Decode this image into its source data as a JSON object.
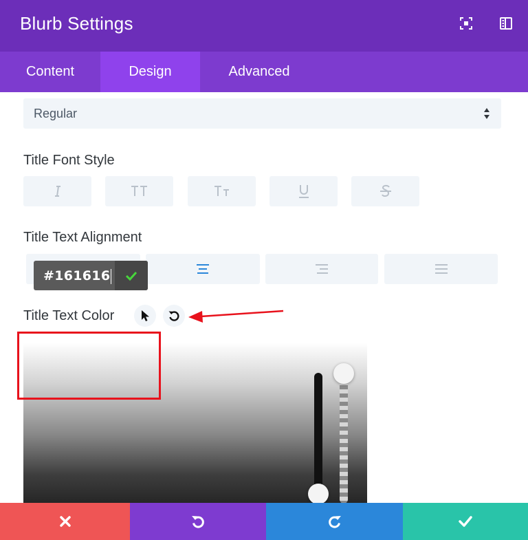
{
  "header": {
    "title": "Blurb Settings",
    "icons": [
      "focus-mode-icon",
      "sidebar-layout-icon"
    ]
  },
  "tabs": [
    {
      "label": "Content",
      "active": false
    },
    {
      "label": "Design",
      "active": true
    },
    {
      "label": "Advanced",
      "active": false
    }
  ],
  "font_weight_select": {
    "value": "Regular"
  },
  "title_font_style": {
    "label": "Title Font Style",
    "buttons": [
      "italic-icon",
      "uppercase-icon",
      "capitalize-icon",
      "underline-icon",
      "strikethrough-icon"
    ]
  },
  "title_text_alignment": {
    "label": "Title Text Alignment",
    "options": [
      "left",
      "center",
      "right",
      "justify"
    ],
    "selected": "center"
  },
  "title_text_color": {
    "label": "Title Text Color",
    "hex_value": "#161616"
  },
  "colors": {
    "header_bg": "#6c2eb9",
    "tab_bar_bg": "#7d3bcf",
    "tab_active_bg": "#8f42ec",
    "accent_blue": "#2b87da",
    "confirm_green": "#47d63b",
    "cancel_red": "#ef5555",
    "undo_purple": "#7e3bd0",
    "redo_blue": "#2b87da",
    "save_teal": "#29c4a9",
    "annotation_red": "#e8121c"
  },
  "footer": {
    "buttons": [
      "close-icon",
      "undo-icon",
      "redo-icon",
      "save-check-icon"
    ]
  }
}
